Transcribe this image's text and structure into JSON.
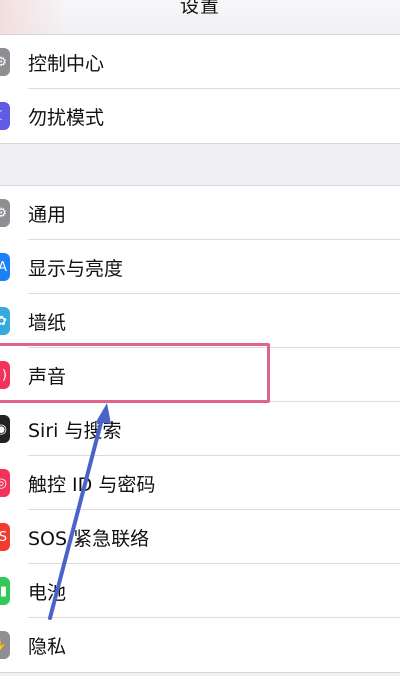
{
  "navbar": {
    "title": "设置"
  },
  "groups": [
    {
      "items": [
        {
          "label": "控制中心",
          "icon": "control-center-icon",
          "color": "#8e8e93"
        },
        {
          "label": "勿扰模式",
          "icon": "moon-icon",
          "color": "#5e5ce6"
        }
      ]
    },
    {
      "items": [
        {
          "label": "通用",
          "icon": "gear-icon",
          "color": "#8e8e93"
        },
        {
          "label": "显示与亮度",
          "icon": "brightness-icon",
          "color": "#1a82f7"
        },
        {
          "label": "墙纸",
          "icon": "wallpaper-icon",
          "color": "#35aadc"
        },
        {
          "label": "声音",
          "icon": "speaker-icon",
          "color": "#f2325a"
        },
        {
          "label": "Siri 与搜索",
          "icon": "siri-icon",
          "color": "#222222"
        },
        {
          "label": "触控 ID 与密码",
          "icon": "fingerprint-icon",
          "color": "#f2325a"
        },
        {
          "label": "SOS 紧急联络",
          "icon": "sos-icon",
          "color": "#f23c32"
        },
        {
          "label": "电池",
          "icon": "battery-icon",
          "color": "#34c759"
        },
        {
          "label": "隐私",
          "icon": "hand-icon",
          "color": "#8e8e93"
        }
      ]
    }
  ],
  "annotation": {
    "highlight_color": "#e0628f",
    "arrow_color": "#4a63c8"
  }
}
